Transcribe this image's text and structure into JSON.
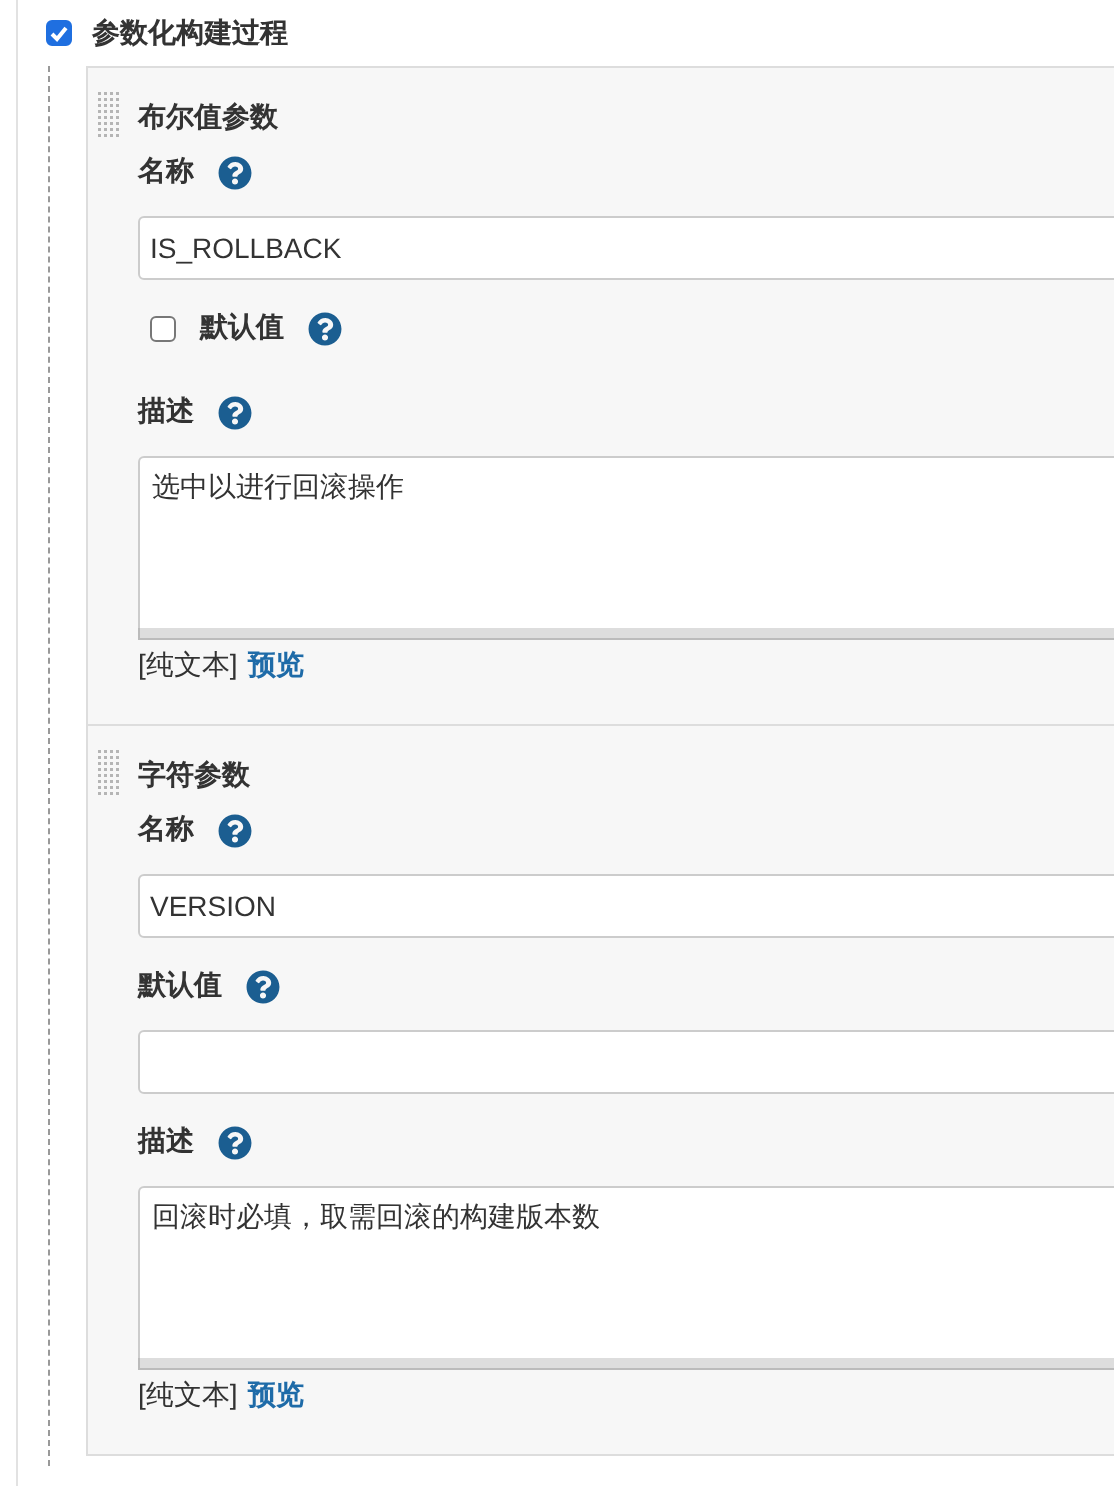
{
  "enable": {
    "label": "参数化构建过程",
    "checked": true
  },
  "parameters": [
    {
      "title": "布尔值参数",
      "fields": [
        {
          "kind": "text",
          "label": "名称",
          "value": "IS_ROLLBACK"
        },
        {
          "kind": "checkbox",
          "label": "默认值",
          "checked": false
        },
        {
          "kind": "textarea",
          "label": "描述",
          "value": "选中以进行回滚操作",
          "format": "[纯文本]",
          "preview": "预览"
        }
      ]
    },
    {
      "title": "字符参数",
      "fields": [
        {
          "kind": "text",
          "label": "名称",
          "value": "VERSION"
        },
        {
          "kind": "text",
          "label": "默认值"
        },
        {
          "kind": "textarea",
          "label": "描述",
          "value": "回滚时必填，取需回滚的构建版本数",
          "format": "[纯文本]",
          "preview": "预览"
        }
      ]
    }
  ]
}
